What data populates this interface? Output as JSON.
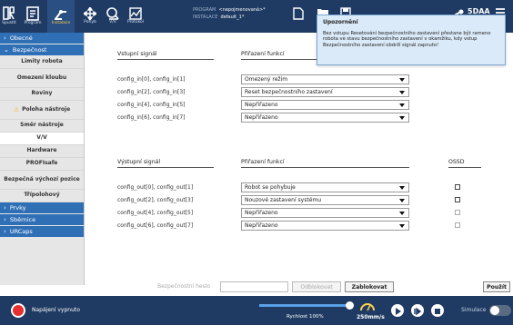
{
  "topbar": {
    "nav": [
      {
        "label": "Spustit",
        "icon": "ur-logo-icon"
      },
      {
        "label": "Program",
        "icon": "program-icon"
      },
      {
        "label": "Instalace",
        "icon": "installation-icon",
        "active": true
      },
      {
        "label": "Pohyb",
        "icon": "move-icon"
      },
      {
        "label": "V/V",
        "icon": "io-icon"
      },
      {
        "label": "Protokol",
        "icon": "log-icon"
      }
    ],
    "program_key": "PROGRAM",
    "program_value": "<nepojmenovaná>*",
    "installation_key": "INSTALACE",
    "installation_value": "default_1*",
    "user_label": "5DAA"
  },
  "tooltip": {
    "title": "Upozornění",
    "body": "Bez vstupu Resetování bezpečnostního zastavení přestane být rameno robota ve stavu bezpečnostního zastavení v okamžiku, kdy vstup Bezpečnostního zastavení obdrží signál zapnuto!"
  },
  "sidebar": {
    "sections": {
      "obecne": "Obecné",
      "bezpecnost": "Bezpečnost",
      "prvky": "Prvky",
      "sbernice": "Sběrnice",
      "urcaps": "URCaps"
    },
    "items": [
      "Limity robota",
      "Omezení kloubu",
      "Roviny",
      "Poloha nástroje",
      "Směr nástroje",
      "V/V",
      "Hardware",
      "PROFIsafe",
      "Bezpečná výchozí pozice",
      "Třípolohový"
    ],
    "selected": "V/V",
    "warning_item": "Poloha nástroje"
  },
  "inputs": {
    "col_signal": "Vstupní signál",
    "col_function": "Přiřazení funkcí",
    "rows": [
      {
        "signal": "config_in[0], config_in[1]",
        "function": "Omezený režim"
      },
      {
        "signal": "config_in[2], config_in[3]",
        "function": "Reset bezpečnostního zastavení"
      },
      {
        "signal": "config_in[4], config_in[5]",
        "function": "Nepřiřazeno"
      },
      {
        "signal": "config_in[6], config_in[7]",
        "function": "Nepřiřazeno"
      }
    ]
  },
  "outputs": {
    "col_signal": "Výstupní signál",
    "col_function": "Přiřazení funkcí",
    "col_ossd": "OSSD",
    "rows": [
      {
        "signal": "config_out[0], config_out[1]",
        "function": "Robot se pohybuje",
        "ossd": false
      },
      {
        "signal": "config_out[2], config_out[3]",
        "function": "Nouzové zastavení systému",
        "ossd": false
      },
      {
        "signal": "config_out[4], config_out[5]",
        "function": "Nepřiřazeno",
        "ossd": false
      },
      {
        "signal": "config_out[6], config_out[7]",
        "function": "Nepřiřazeno",
        "ossd": false
      }
    ]
  },
  "password": {
    "label": "Bezpečnostní heslo",
    "unlock": "Odblokovat",
    "lock": "Zablokovat",
    "apply": "Použít"
  },
  "footer": {
    "power_label": "Napájení vypnuto",
    "speed_label": "Rychlost 100%",
    "speed_fraction": 1.0,
    "tcp_speed": "250mm/s",
    "simulation_label": "Simulace"
  },
  "colors": {
    "topbar": "#1f3b63",
    "accent": "#2f6fb6",
    "power": "#e63030",
    "warning": "#f2b71e",
    "tooltip_bg": "#dbeaf8"
  }
}
